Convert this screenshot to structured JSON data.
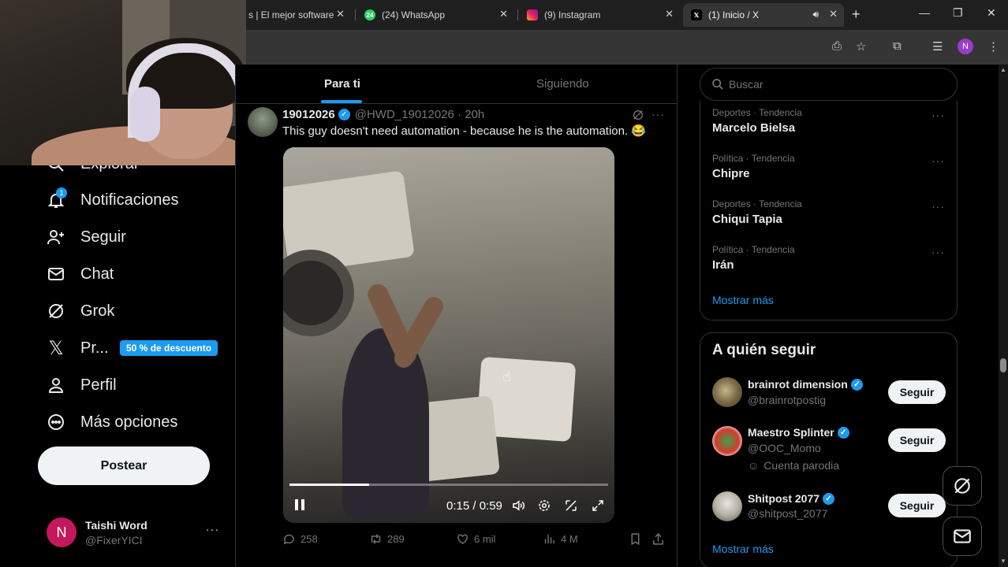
{
  "browser": {
    "tabs": [
      {
        "label": "s | El mejor software",
        "icon_label": ""
      },
      {
        "label": "(24) WhatsApp",
        "icon_label": "24"
      },
      {
        "label": "(9) Instagram",
        "icon_label": ""
      },
      {
        "label": "(1) Inicio / X",
        "icon_label": ""
      }
    ],
    "profile_initial": "N"
  },
  "nav": {
    "explore_label": "Explorar",
    "notifications_label": "Notificaciones",
    "notifications_count": "1",
    "follow_label": "Seguir",
    "chat_label": "Chat",
    "grok_label": "Grok",
    "premium_label": "Pr...",
    "premium_promo": "50 % de descuento",
    "profile_label": "Perfil",
    "more_label": "Más opciones",
    "post_button": "Postear"
  },
  "account": {
    "initial": "N",
    "name": "Taishi Word",
    "handle": "@FixerYICI"
  },
  "feed": {
    "tabs": [
      "Para ti",
      "Siguiendo"
    ],
    "tweet": {
      "author": "19012026",
      "handle_time": "@HWD_19012026 · 20h",
      "text": "This guy doesn't need automation - because he is the automation. 😂",
      "video_time": "0:15 / 0:59",
      "video_progress": 0.25,
      "replies": "258",
      "reposts": "289",
      "likes": "6 mil",
      "views": "4 M"
    }
  },
  "sidebar": {
    "search_placeholder": "Buscar",
    "trends": [
      {
        "category": "Deportes · Tendencia",
        "name": "Marcelo Bielsa"
      },
      {
        "category": "Política · Tendencia",
        "name": "Chipre"
      },
      {
        "category": "Deportes · Tendencia",
        "name": "Chiqui Tapia"
      },
      {
        "category": "Política · Tendencia",
        "name": "Irán"
      }
    ],
    "trends_more": "Mostrar más",
    "who_to_follow_title": "A quién seguir",
    "who_to_follow": [
      {
        "name": "brainrot dimension",
        "handle": "@brainrotpostig",
        "note": ""
      },
      {
        "name": "Maestro Splinter",
        "handle": "@OOC_Momo",
        "note": "Cuenta parodia"
      },
      {
        "name": "Shitpost 2077",
        "handle": "@shitpost_2077",
        "note": ""
      }
    ],
    "follow_button": "Seguir",
    "wtf_more": "Mostrar más"
  }
}
